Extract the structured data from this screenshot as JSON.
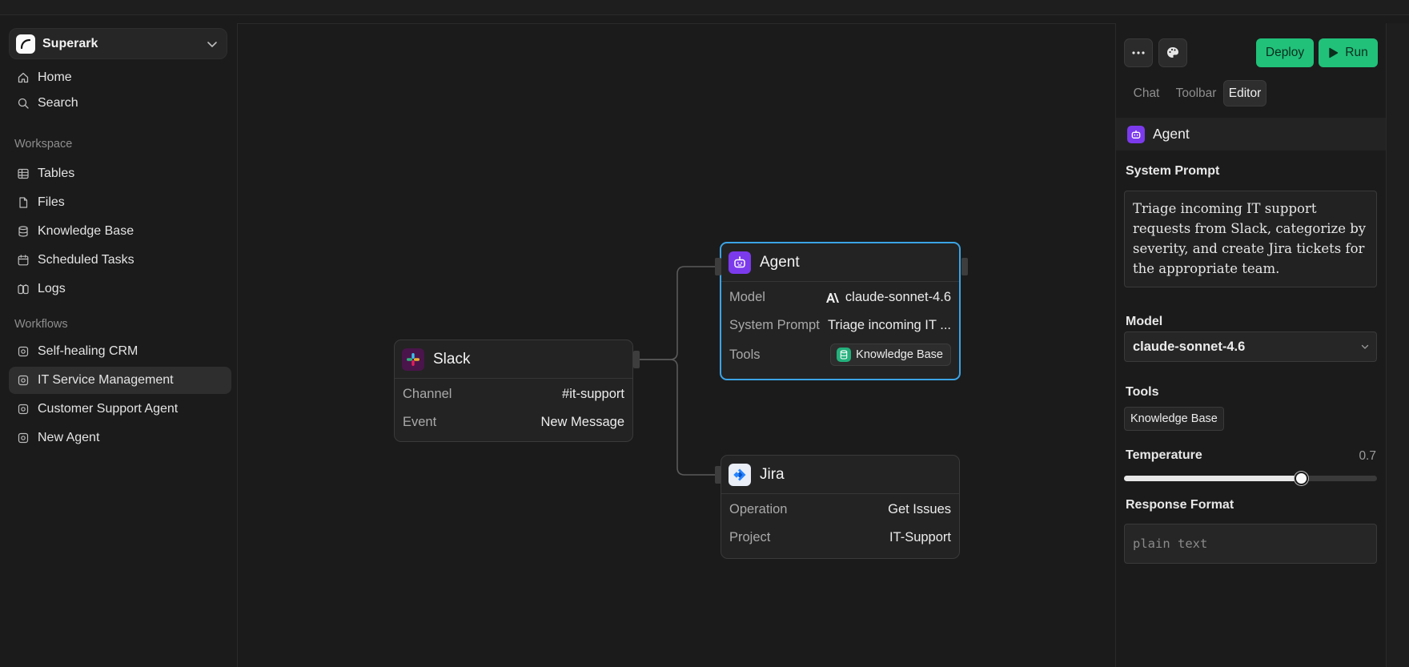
{
  "workspace": {
    "name": "Superark",
    "logo_icon": "superark-logo-icon"
  },
  "nav": {
    "main": [
      {
        "label": "Home",
        "icon": "home-icon"
      },
      {
        "label": "Search",
        "icon": "search-icon"
      }
    ],
    "workspace_heading": "Workspace",
    "workspace_items": [
      {
        "label": "Tables",
        "icon": "table-icon"
      },
      {
        "label": "Files",
        "icon": "file-icon"
      },
      {
        "label": "Knowledge Base",
        "icon": "database-icon"
      },
      {
        "label": "Scheduled Tasks",
        "icon": "calendar-icon"
      },
      {
        "label": "Logs",
        "icon": "logs-icon"
      }
    ],
    "workflows_heading": "Workflows",
    "workflow_items": [
      {
        "label": "Self-healing CRM",
        "icon": "workflow-icon"
      },
      {
        "label": "IT Service Management",
        "icon": "workflow-icon",
        "active": true
      },
      {
        "label": "Customer Support Agent",
        "icon": "workflow-icon"
      },
      {
        "label": "New Agent",
        "icon": "workflow-icon"
      }
    ]
  },
  "canvas": {
    "slack_node": {
      "title": "Slack",
      "rows": [
        {
          "key": "Channel",
          "value": "#it-support"
        },
        {
          "key": "Event",
          "value": "New Message"
        }
      ]
    },
    "agent_node": {
      "title": "Agent",
      "rows": [
        {
          "key": "Model",
          "value": "claude-sonnet-4.6"
        },
        {
          "key": "System Prompt",
          "value": "Triage incoming IT ..."
        },
        {
          "key": "Tools",
          "value": "Knowledge Base"
        }
      ]
    },
    "jira_node": {
      "title": "Jira",
      "rows": [
        {
          "key": "Operation",
          "value": "Get Issues"
        },
        {
          "key": "Project",
          "value": "IT-Support"
        }
      ]
    }
  },
  "panel": {
    "buttons": {
      "more": "more-icon",
      "theme": "palette-icon",
      "deploy": "Deploy",
      "run": "Run"
    },
    "tabs": [
      "Chat",
      "Toolbar",
      "Editor"
    ],
    "active_tab": "Editor",
    "section_title": "Agent",
    "system_prompt_label": "System Prompt",
    "system_prompt_value": "Triage incoming IT support requests from Slack, categorize by severity, and create Jira tickets for the appropriate team.",
    "model_label": "Model",
    "model_value": "claude-sonnet-4.6",
    "tools_label": "Tools",
    "tools": [
      "Knowledge Base"
    ],
    "temperature_label": "Temperature",
    "temperature_value": "0.7",
    "temperature_fraction": 0.7,
    "response_format_label": "Response Format",
    "response_format_placeholder": "plain text"
  },
  "colors": {
    "accent_blue": "#3ba4e6",
    "run_green": "#21c17a",
    "agent_purple": "#7c3aed",
    "kb_green": "#23b07c"
  }
}
